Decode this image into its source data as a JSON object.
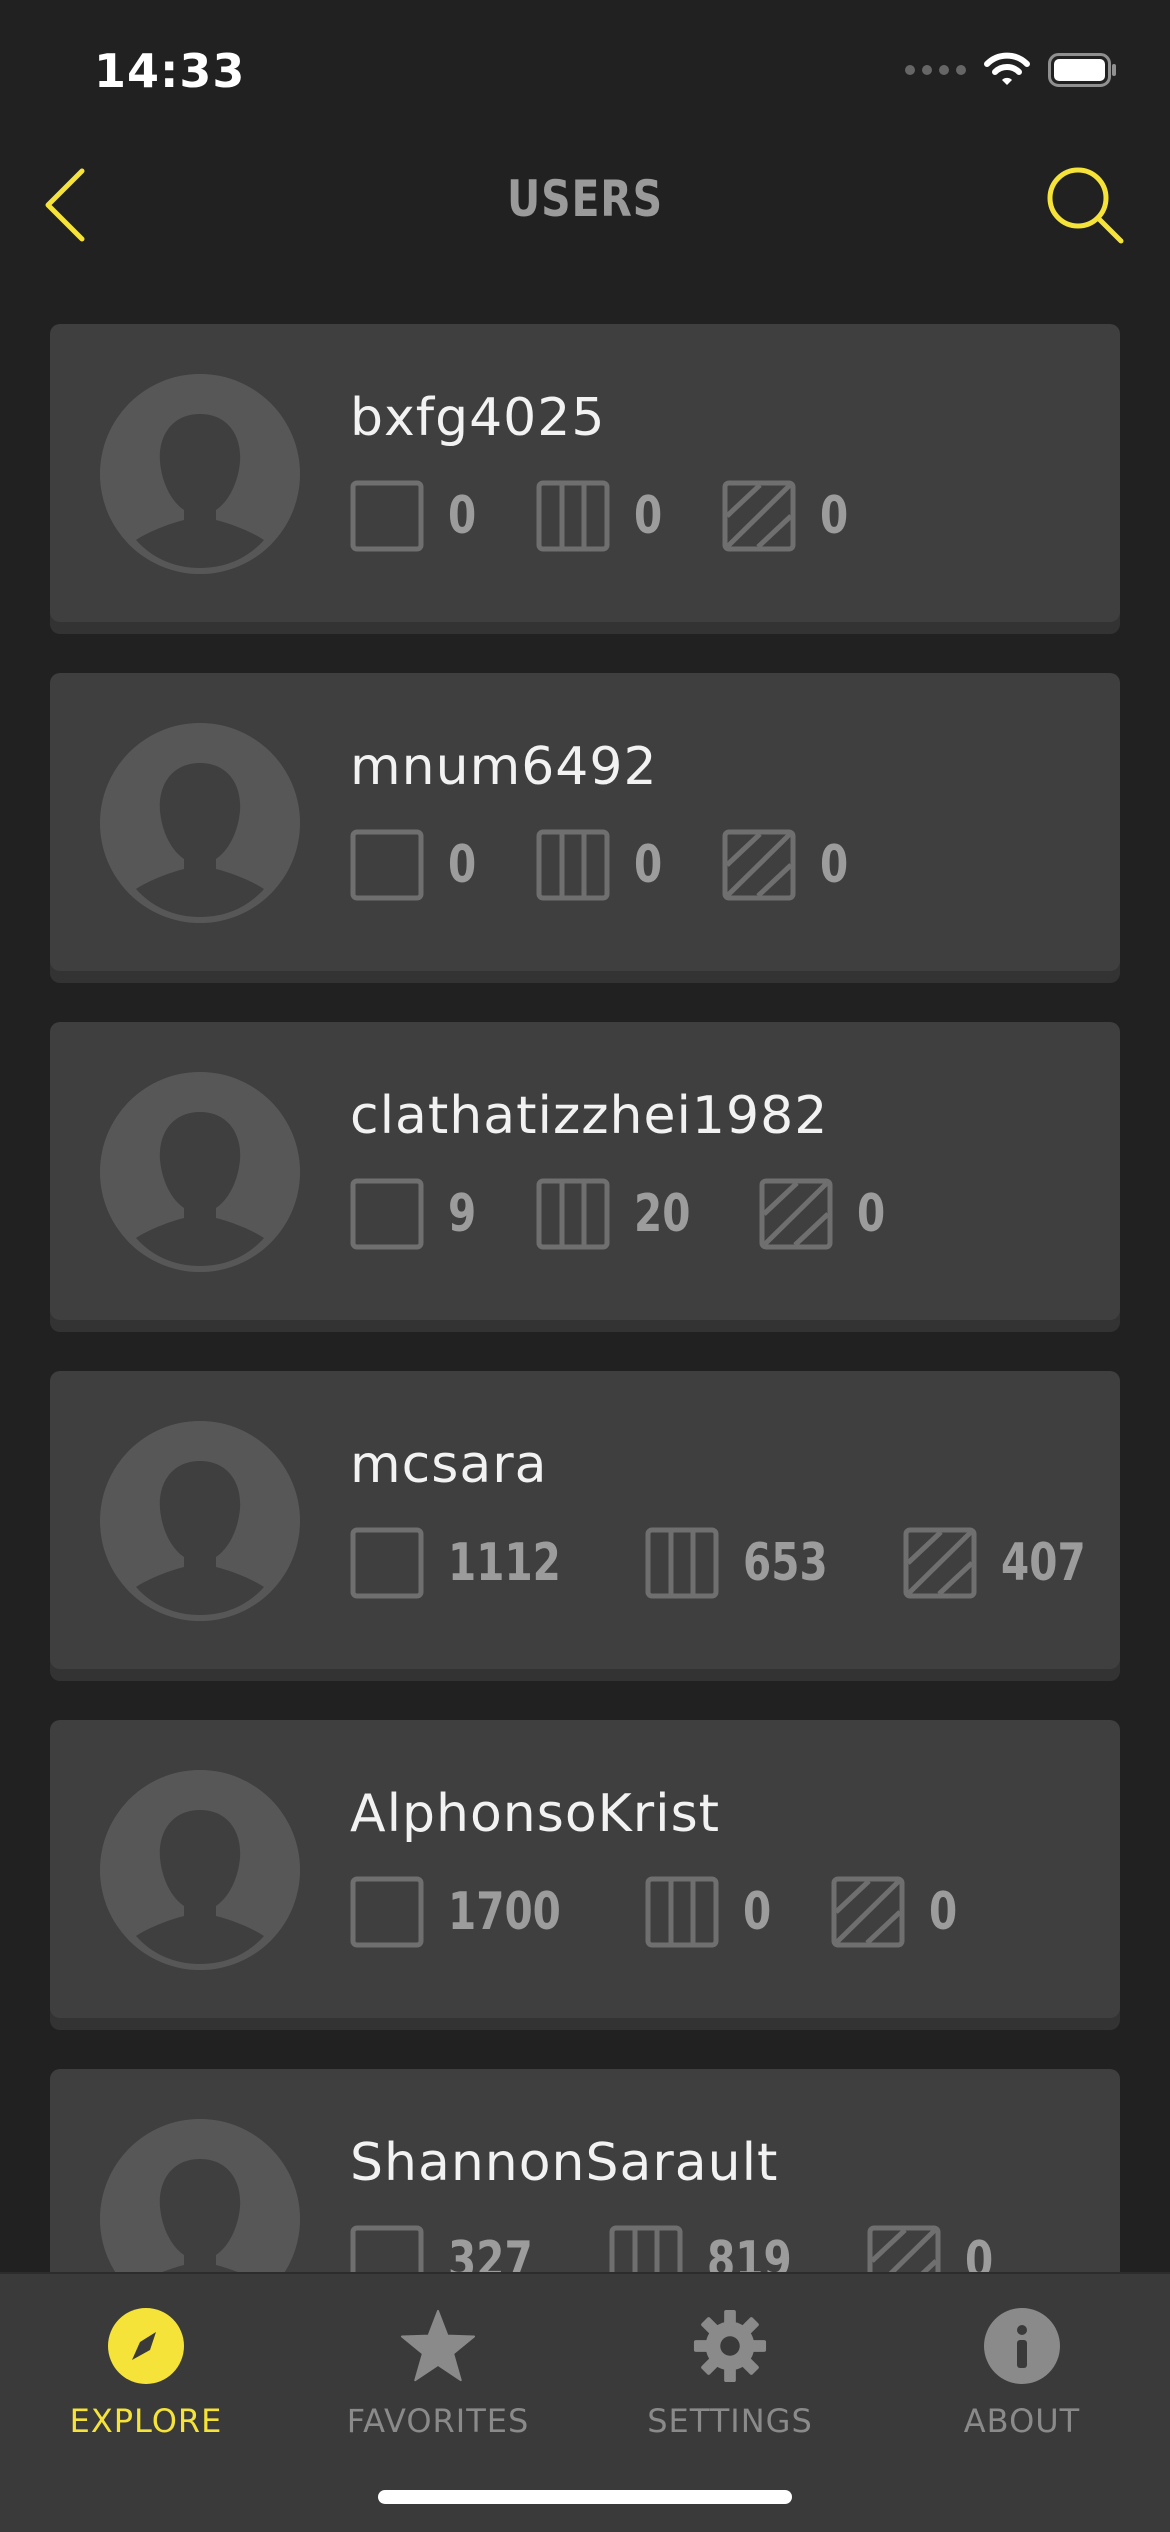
{
  "status": {
    "time": "14:33"
  },
  "nav": {
    "title": "USERS"
  },
  "users": [
    {
      "name": "bxfg4025",
      "stats": [
        "0",
        "0",
        "0"
      ]
    },
    {
      "name": "mnum6492",
      "stats": [
        "0",
        "0",
        "0"
      ]
    },
    {
      "name": "clathatizzhei1982",
      "stats": [
        "9",
        "20",
        "0"
      ]
    },
    {
      "name": "mcsara",
      "stats": [
        "1112",
        "653",
        "407"
      ]
    },
    {
      "name": "AlphonsoKrist",
      "stats": [
        "1700",
        "0",
        "0"
      ]
    },
    {
      "name": "ShannonSarault",
      "stats": [
        "327",
        "819",
        "0"
      ]
    }
  ],
  "stat_icons": [
    "square-icon",
    "columns-icon",
    "hatched-square-icon"
  ],
  "tabs": [
    {
      "label": "EXPLORE",
      "icon": "compass-icon",
      "active": true
    },
    {
      "label": "FAVORITES",
      "icon": "star-icon",
      "active": false
    },
    {
      "label": "SETTINGS",
      "icon": "gear-icon",
      "active": false
    },
    {
      "label": "ABOUT",
      "icon": "info-icon",
      "active": false
    }
  ],
  "colors": {
    "accent": "#f5e33a",
    "background": "#212121",
    "card": "#3f3f3f",
    "muted": "#8a8a8a"
  }
}
